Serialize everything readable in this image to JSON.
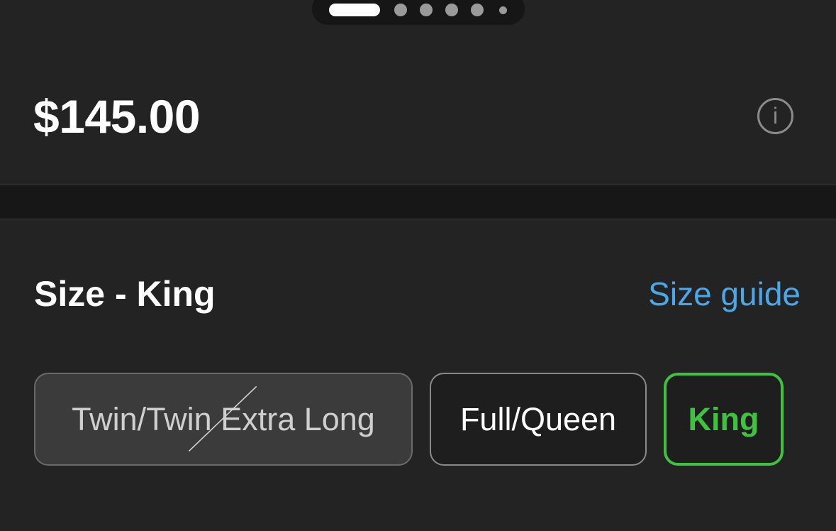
{
  "pager": {
    "page_count": 6,
    "current_page": 1
  },
  "product": {
    "price": "$145.00"
  },
  "info_icon": "info-icon",
  "size": {
    "title": "Size - King",
    "guide_label": "Size guide",
    "options": [
      {
        "label": "Twin/Twin Extra Long",
        "state": "unavailable"
      },
      {
        "label": "Full/Queen",
        "state": "available"
      },
      {
        "label": "King",
        "state": "selected"
      }
    ]
  },
  "colors": {
    "background": "#232323",
    "accent_link": "#4aa8ea",
    "selected": "#3fc33f"
  }
}
